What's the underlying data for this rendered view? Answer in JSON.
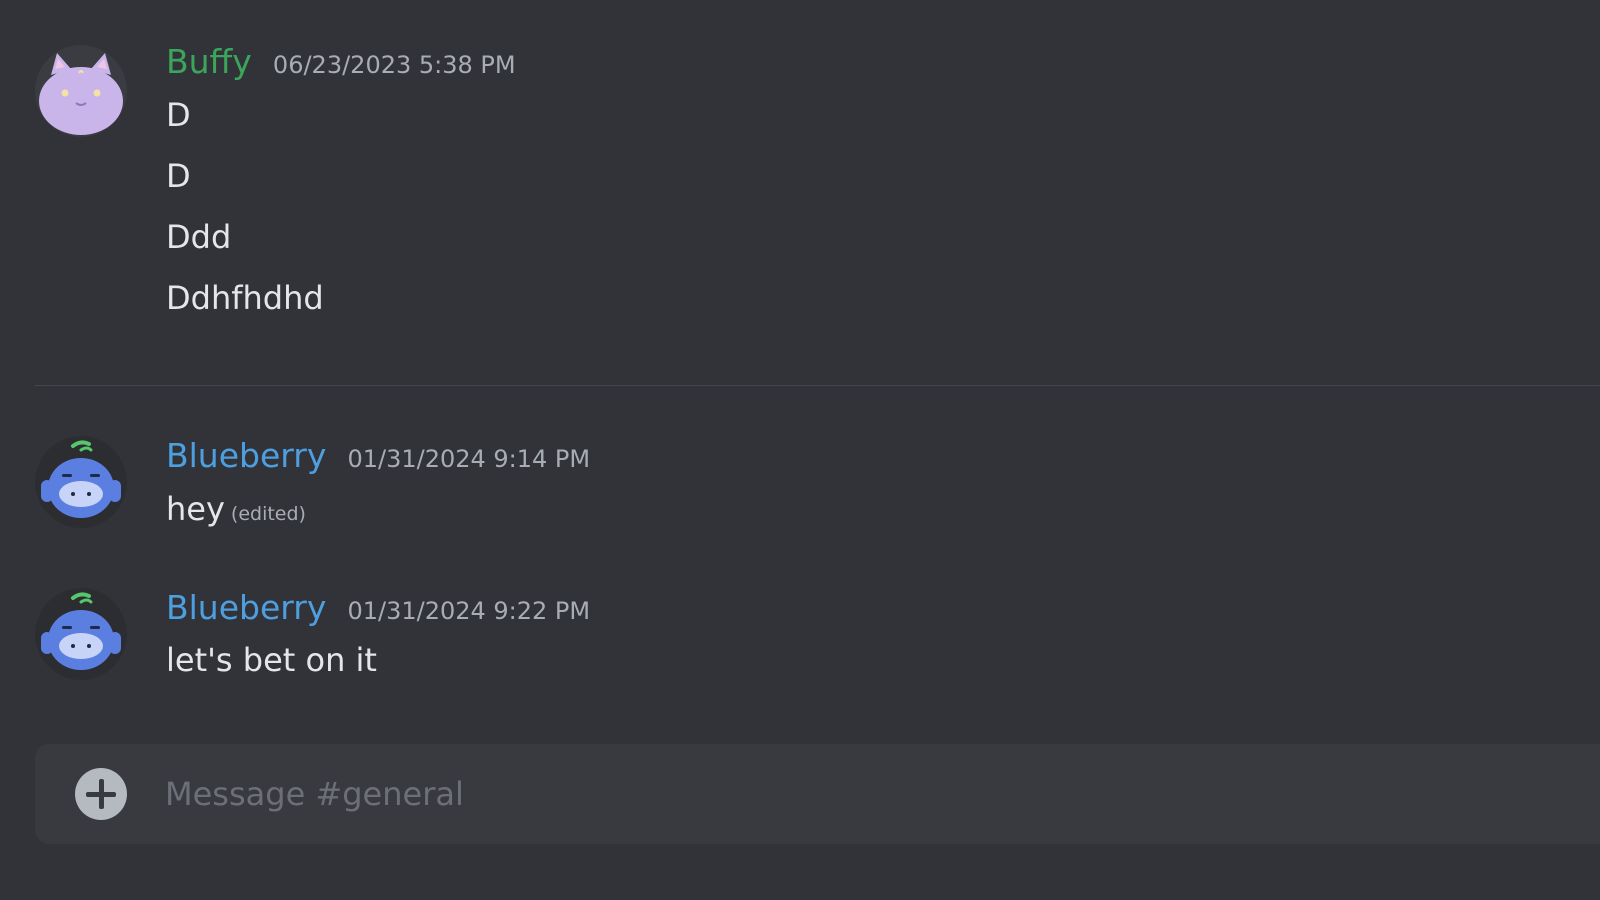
{
  "colors": {
    "background": "#313338",
    "buffy_name": "#3ba55c",
    "blueberry_name": "#4e9fe0",
    "message_text": "#e4e6ea",
    "timestamp": "#a8acb3"
  },
  "messages": [
    {
      "username": "Buffy",
      "timestamp": "06/23/2023 5:38 PM",
      "avatar": "purple-cat-avatar-icon",
      "lines": [
        "D",
        "D",
        "Ddd",
        "Ddhfhdhd"
      ]
    },
    {
      "username": "Blueberry",
      "timestamp": "01/31/2024 9:14 PM",
      "avatar": "blue-discord-robot-avatar-icon",
      "lines": [
        "hey"
      ],
      "edited": "(edited)"
    },
    {
      "username": "Blueberry",
      "timestamp": "01/31/2024 9:22 PM",
      "avatar": "blue-discord-robot-avatar-icon",
      "lines": [
        "let's bet on it"
      ]
    }
  ],
  "composer": {
    "placeholder": "Message #general",
    "attach_icon": "plus-circle-icon"
  }
}
